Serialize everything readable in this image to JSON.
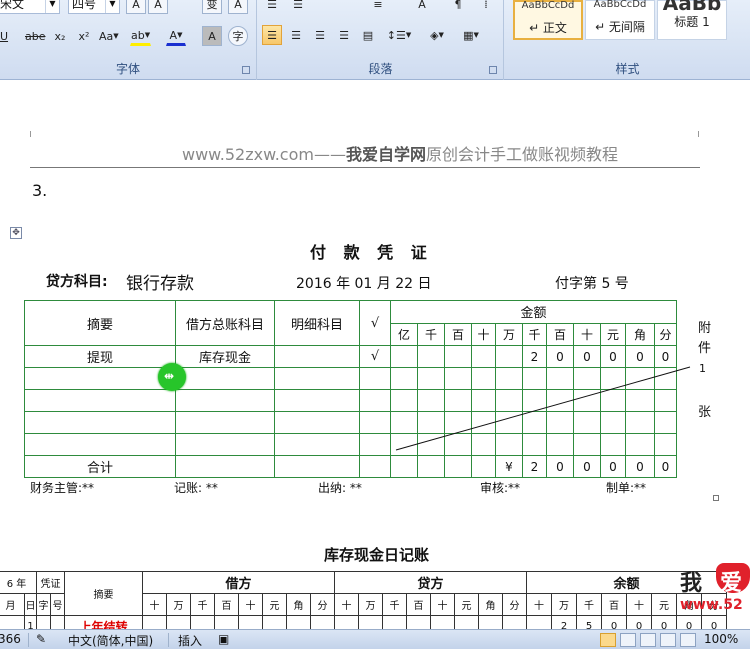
{
  "ribbon": {
    "font_group": {
      "label": "字体",
      "font_name": "宋文",
      "font_size": "四号",
      "buttons": {
        "grow": "A",
        "shrink": "A",
        "underline": "U",
        "strike": "abe",
        "subscript": "x₂",
        "superscript": "x²",
        "change_case": "Aa",
        "highlight": "ab",
        "font_color": "A",
        "char_shade": "A",
        "enclose": "字",
        "phonetic": "变",
        "border": "A"
      }
    },
    "paragraph_group": {
      "label": "段落"
    },
    "styles_group": {
      "label": "样式",
      "styles": [
        {
          "sample": "AaBbCcDd",
          "name": "↵ 正文"
        },
        {
          "sample": "AaBbCcDd",
          "name": "↵ 无间隔"
        },
        {
          "sample": "AaBb",
          "name": "标题 1"
        }
      ]
    }
  },
  "document": {
    "watermark_prefix": "www.52zxw.com——",
    "watermark_brand": "我爱自学网",
    "watermark_suffix": "原创会计手工做账视频教程",
    "step": "3.",
    "voucher": {
      "title": "付 款 凭 证",
      "credit_label": "贷方科目:",
      "credit_value": "银行存款",
      "date": "2016 年 01 月 22 日",
      "number": "付字第 5 号",
      "headers": {
        "summary": "摘要",
        "debit_account": "借方总账科目",
        "detail_account": "明细科目",
        "check": "√",
        "amount": "金额"
      },
      "digit_headers": [
        "亿",
        "千",
        "百",
        "十",
        "万",
        "千",
        "百",
        "十",
        "元",
        "角",
        "分"
      ],
      "row1": {
        "summary": "提现",
        "account": "库存现金",
        "check": "√",
        "digits": [
          "",
          "",
          "",
          "",
          "",
          "2",
          "0",
          "0",
          "0",
          "0",
          "0"
        ]
      },
      "total": {
        "label": "合计",
        "digits": [
          "",
          "",
          "",
          "",
          "¥",
          "2",
          "0",
          "0",
          "0",
          "0",
          "0"
        ]
      },
      "attachments": {
        "label_top": "附件",
        "count": "1",
        "unit": "张"
      },
      "signatures": [
        "财务主管:**",
        "记账: **",
        "出纳: **",
        "审核:**",
        "制单:**"
      ]
    },
    "ledger": {
      "title": "库存现金日记账",
      "year_header": "6 年",
      "voucher_header": "凭证",
      "summary_header": "摘要",
      "debit_header": "借方",
      "credit_header": "贷方",
      "balance_header": "余额",
      "sub_headers": {
        "month": "月",
        "day": "日",
        "kind": "字",
        "num": "号"
      },
      "digits": [
        "十",
        "万",
        "千",
        "百",
        "十",
        "元",
        "角",
        "分"
      ],
      "first_row": {
        "day": "1",
        "summary": "上年结转",
        "balance": [
          "",
          "2",
          "5",
          "0",
          "0",
          "0",
          "0",
          "0"
        ]
      }
    },
    "logo_text": {
      "w1": "我",
      "w2": "爱",
      "url": "www.52"
    }
  },
  "statusbar": {
    "word_count": "366",
    "language": "中文(简体,中国)",
    "mode": "插入",
    "zoom": "100%"
  }
}
